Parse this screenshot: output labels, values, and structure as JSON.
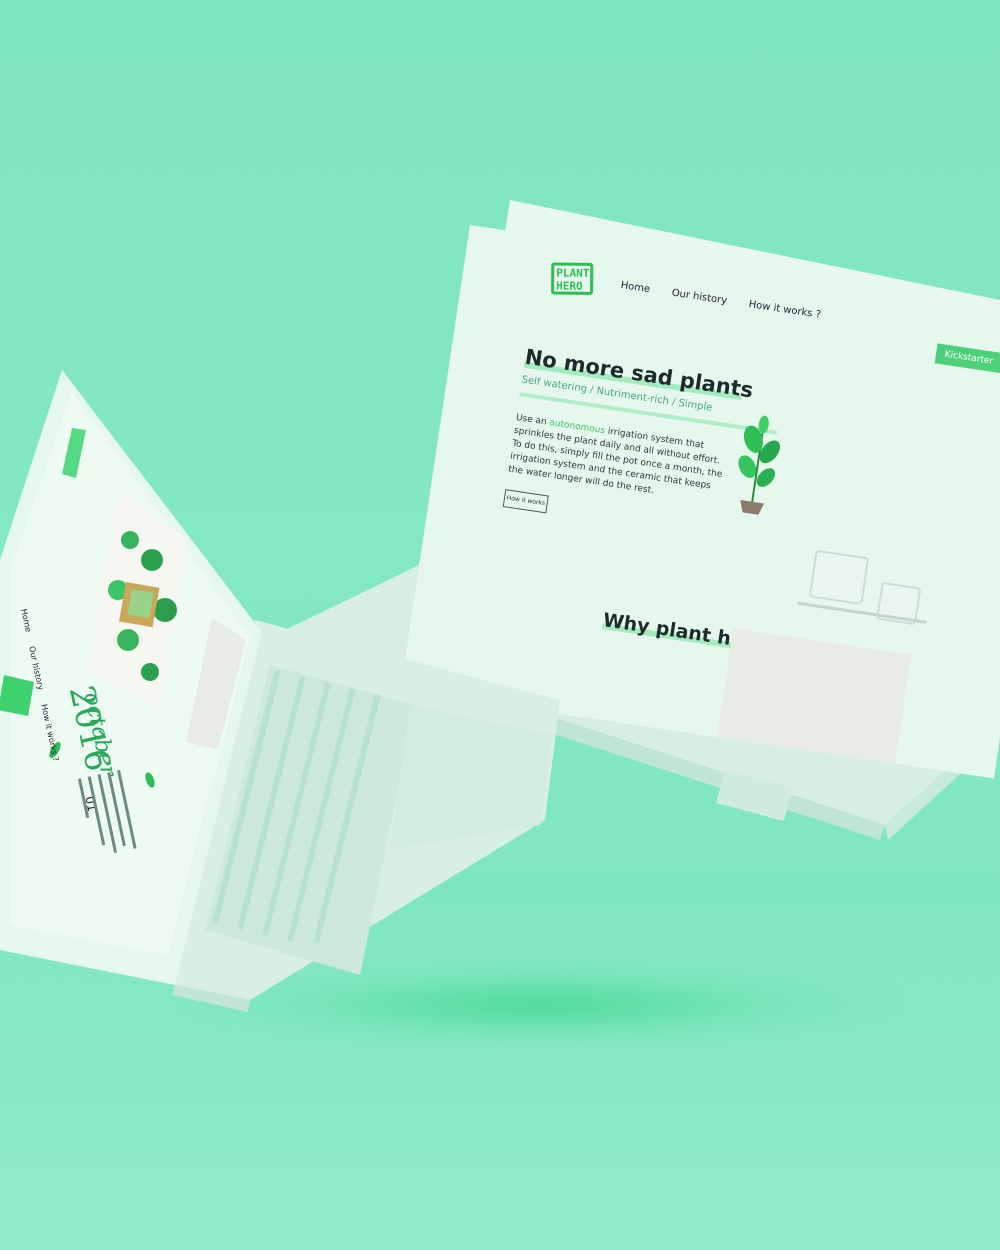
{
  "scene": {
    "description_colors": {
      "background": "#80e6c0",
      "accent": "#3fc46a"
    }
  },
  "right_laptop": {
    "logo": "PLANT HERO",
    "nav": [
      "Home",
      "Our history",
      "How it works ?"
    ],
    "cta": "Kickstarter",
    "hero_title": "No more sad plants",
    "hero_subtitle": "Self watering / Nutriment-rich / Simple",
    "paragraph_before": "Use an ",
    "paragraph_highlight": "autonomous",
    "paragraph_after": " irrigation system that sprinkles the plant daily and all without effort. To do this, simply fill the pot once a month, the irrigation system and the ceramic that keeps the water longer will do the rest.",
    "button": "How it works",
    "section_title": "Why plant hero ?"
  },
  "left_laptop": {
    "nav": [
      "Home",
      "Our history",
      "How it works ?"
    ],
    "year": "2016",
    "month": "october",
    "entry_number": "01"
  }
}
